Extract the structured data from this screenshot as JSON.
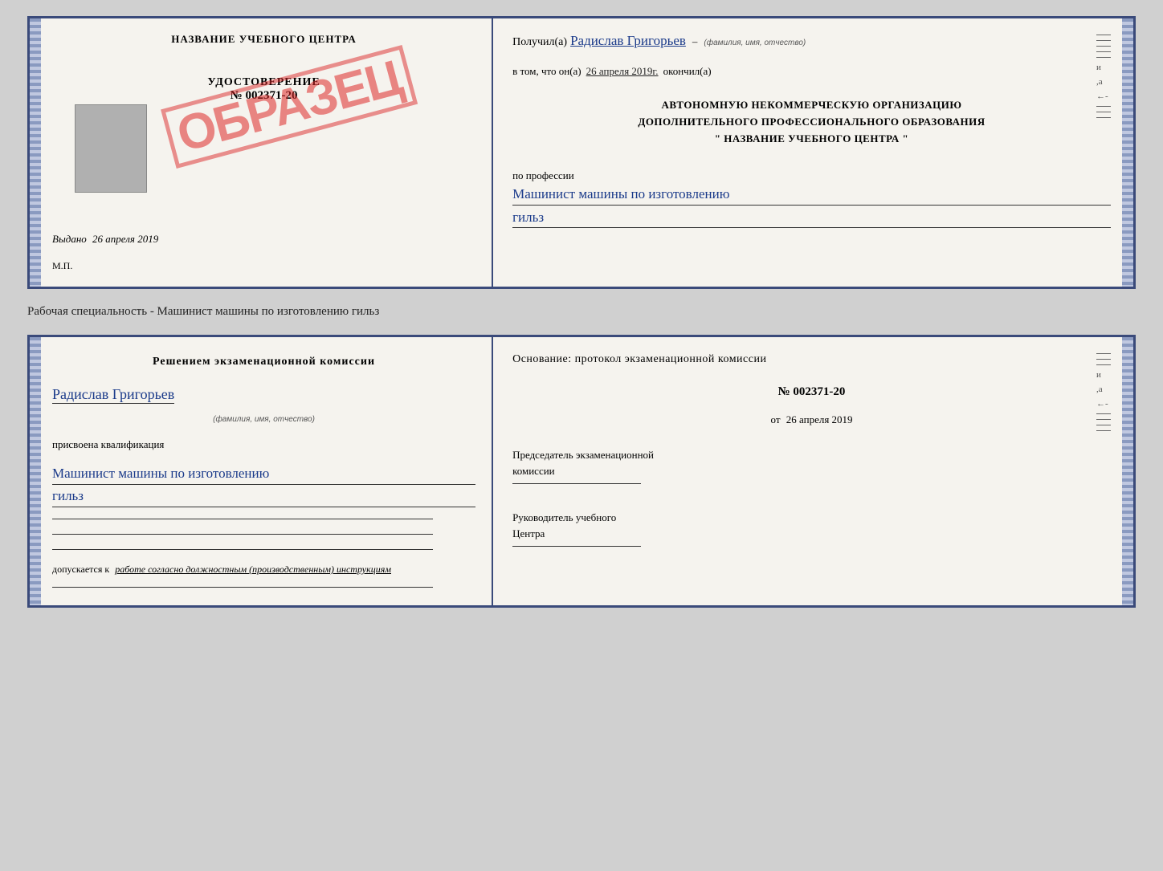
{
  "top_doc": {
    "left": {
      "center_title": "НАЗВАНИЕ УЧЕБНОГО ЦЕНТРА",
      "udostoverenie_label": "УДОСТОВЕРЕНИЕ",
      "udostoverenie_number": "№ 002371-20",
      "obrazets": "ОБРАЗЕЦ",
      "vydano_label": "Выдано",
      "vydano_date": "26 апреля 2019",
      "mp_label": "М.П."
    },
    "right": {
      "poluchil_label": "Получил(а)",
      "fio_value": "Радислав Григорьев",
      "fio_sublabel": "(фамилия, имя, отчество)",
      "vtom_label": "в том, что он(а)",
      "date_value": "26 апреля 2019г.",
      "okonchil_label": "окончил(а)",
      "avtonom_line1": "АВТОНОМНУЮ НЕКОММЕРЧЕСКУЮ ОРГАНИЗАЦИЮ",
      "avtonom_line2": "ДОПОЛНИТЕЛЬНОГО ПРОФЕССИОНАЛЬНОГО ОБРАЗОВАНИЯ",
      "center_name_label": "\" НАЗВАНИЕ УЧЕБНОГО ЦЕНТРА \"",
      "po_professii_label": "по профессии",
      "professiya_line1": "Машинист машины по изготовлению",
      "professiya_line2": "гильз"
    }
  },
  "specialty_line": "Рабочая специальность - Машинист машины по изготовлению гильз",
  "bottom_doc": {
    "left": {
      "resheniem_label": "Решением  экзаменационной  комиссии",
      "fio_value": "Радислав Григорьев",
      "fio_sublabel": "(фамилия, имя, отчество)",
      "prisvoena_label": "присвоена квалификация",
      "kvalif_line1": "Машинист машины по изготовлению",
      "kvalif_line2": "гильз",
      "dopuskaetsya_prefix": "допускается к",
      "dopuskaetsya_italic": "работе согласно должностным (производственным) инструкциям"
    },
    "right": {
      "osnovanie_label": "Основание: протокол экзаменационной  комиссии",
      "protocol_number": "№  002371-20",
      "ot_prefix": "от",
      "ot_date": "26 апреля 2019",
      "predsedatel_line1": "Председатель экзаменационной",
      "predsedatel_line2": "комиссии",
      "rukovoditel_line1": "Руководитель учебного",
      "rukovoditel_line2": "Центра"
    }
  }
}
